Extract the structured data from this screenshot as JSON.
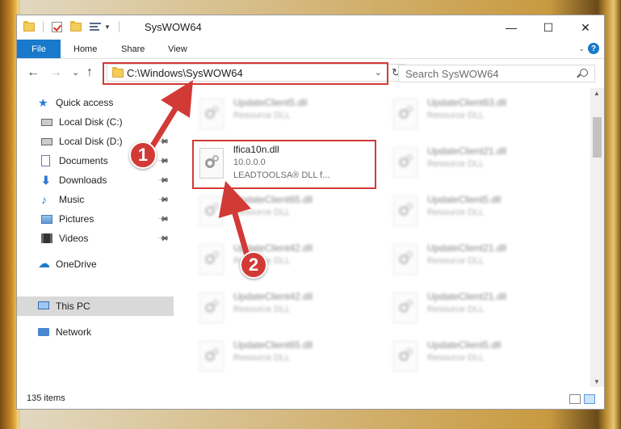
{
  "window": {
    "title": "SysWOW64",
    "minimize": "—",
    "maximize": "☐",
    "close": "✕"
  },
  "ribbon": {
    "tabs": [
      "File",
      "Home",
      "Share",
      "View"
    ],
    "expand": "⌄",
    "help": "?"
  },
  "navigation": {
    "back": "←",
    "forward": "→",
    "recent": "⌄",
    "up": "↑",
    "address": "C:\\Windows\\SysWOW64",
    "address_dropdown": "⌄",
    "refresh": "↻",
    "search_placeholder": "Search SysWOW64"
  },
  "sidebar": {
    "items": [
      {
        "label": "Quick access",
        "icon": "star-icon"
      },
      {
        "label": "Local Disk (C:)",
        "icon": "drive-icon"
      },
      {
        "label": "Local Disk (D:)",
        "icon": "drive-icon"
      },
      {
        "label": "Documents",
        "icon": "documents-icon"
      },
      {
        "label": "Downloads",
        "icon": "downloads-icon"
      },
      {
        "label": "Music",
        "icon": "music-icon"
      },
      {
        "label": "Pictures",
        "icon": "pictures-icon"
      },
      {
        "label": "Videos",
        "icon": "videos-icon"
      },
      {
        "label": "OneDrive",
        "icon": "onedrive-icon"
      },
      {
        "label": "This PC",
        "icon": "this-pc-icon"
      },
      {
        "label": "Network",
        "icon": "network-icon"
      }
    ],
    "pin": "📌"
  },
  "files": {
    "highlighted": {
      "name": "lfica10n.dll",
      "version": "10.0.0.0",
      "description": "LEADTOOLSA® DLL f..."
    },
    "left_column": [
      {
        "name": "UpdateClient5.dll",
        "type": "Resource DLL"
      },
      {
        "name": "UpdateClient65.dll",
        "type": "Resource DLL"
      },
      {
        "name": "UpdateClient42.dll",
        "type": "Resource DLL"
      },
      {
        "name": "UpdateClient42.dll",
        "type": "Resource DLL"
      },
      {
        "name": "UpdateClient65.dll",
        "type": "Resource DLL"
      }
    ],
    "right_column": [
      {
        "name": "UpdateClient63.dll",
        "type": "Resource DLL"
      },
      {
        "name": "UpdateClient21.dll",
        "type": "Resource DLL"
      },
      {
        "name": "UpdateClient5.dll",
        "type": "Resource DLL"
      },
      {
        "name": "UpdateClient21.dll",
        "type": "Resource DLL"
      },
      {
        "name": "UpdateClient21.dll",
        "type": "Resource DLL"
      },
      {
        "name": "UpdateClient5.dll",
        "type": "Resource DLL"
      }
    ]
  },
  "status": {
    "count": "135 items"
  },
  "annotations": {
    "step1": "1",
    "step2": "2",
    "color": "#d23a36"
  }
}
